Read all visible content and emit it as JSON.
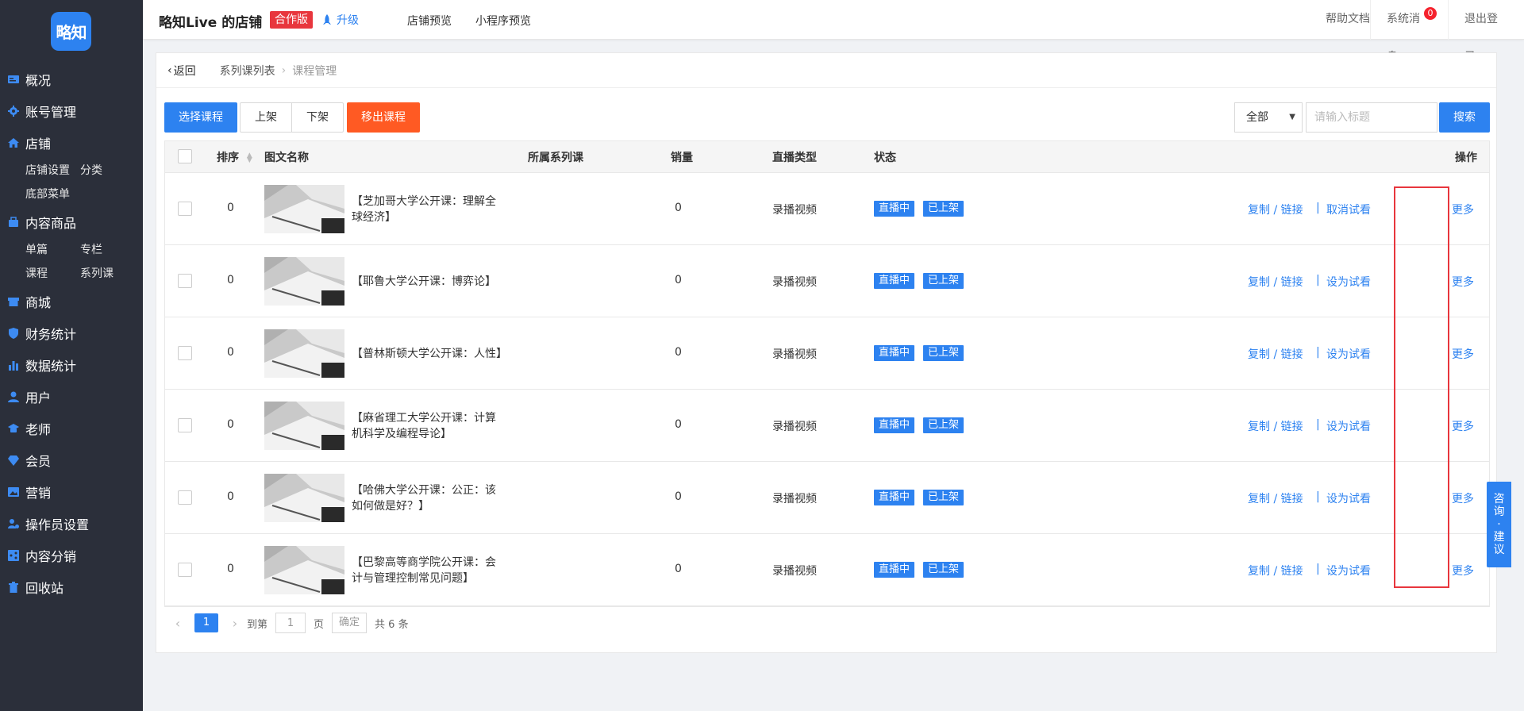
{
  "sidebar": {
    "logo_text": "略知",
    "groups": [
      {
        "label": "概况",
        "icon": "card-icon"
      },
      {
        "label": "账号管理",
        "icon": "gear-icon"
      },
      {
        "label": "店铺",
        "icon": "home-icon",
        "subs": [
          "店铺设置",
          "分类",
          "底部菜单"
        ]
      },
      {
        "label": "内容商品",
        "icon": "bag-icon",
        "subs": [
          "单篇",
          "专栏",
          "课程",
          "系列课"
        ]
      },
      {
        "label": "商城",
        "icon": "store-icon"
      },
      {
        "label": "财务统计",
        "icon": "shield-icon"
      },
      {
        "label": "数据统计",
        "icon": "bar-chart-icon"
      },
      {
        "label": "用户",
        "icon": "user-icon"
      },
      {
        "label": "老师",
        "icon": "mortarboard-icon"
      },
      {
        "label": "会员",
        "icon": "diamond-icon"
      },
      {
        "label": "营销",
        "icon": "picture-icon"
      },
      {
        "label": "操作员设置",
        "icon": "user-gear-icon"
      },
      {
        "label": "内容分销",
        "icon": "share-icon"
      },
      {
        "label": "回收站",
        "icon": "trash-icon"
      }
    ]
  },
  "header": {
    "shop_title": "略知Live 的店铺",
    "edition_badge": "合作版",
    "upgrade_label": "升级",
    "links": [
      "店铺预览",
      "小程序预览"
    ],
    "help": "帮助文档",
    "messages": "系统消息",
    "message_count": "0",
    "logout": "退出登录"
  },
  "breadcrumb": {
    "back": "返回",
    "parent": "系列课列表",
    "current": "课程管理"
  },
  "toolbar": {
    "select_course": "选择课程",
    "list_on": "上架",
    "list_off": "下架",
    "remove_course": "移出课程",
    "filter_value": "全部",
    "search_placeholder": "请输入标题",
    "search": "搜索"
  },
  "table": {
    "headers": {
      "sort": "排序",
      "name": "图文名称",
      "series": "所属系列课",
      "sales": "销量",
      "live_type": "直播类型",
      "status": "状态",
      "actions": "操作"
    },
    "rows": [
      {
        "sort": "0",
        "title": "【芝加哥大学公开课：理解全球经济】",
        "sales": "0",
        "live_type": "录播视频",
        "tag_live": "直播中",
        "tag_listed": "已上架",
        "copy": "复制 / 链接",
        "trial": "取消试看",
        "more": "更多"
      },
      {
        "sort": "0",
        "title": "【耶鲁大学公开课：博弈论】",
        "sales": "0",
        "live_type": "录播视频",
        "tag_live": "直播中",
        "tag_listed": "已上架",
        "copy": "复制 / 链接",
        "trial": "设为试看",
        "more": "更多"
      },
      {
        "sort": "0",
        "title": "【普林斯顿大学公开课：人性】",
        "sales": "0",
        "live_type": "录播视频",
        "tag_live": "直播中",
        "tag_listed": "已上架",
        "copy": "复制 / 链接",
        "trial": "设为试看",
        "more": "更多"
      },
      {
        "sort": "0",
        "title": "【麻省理工大学公开课：计算机科学及编程导论】",
        "sales": "0",
        "live_type": "录播视频",
        "tag_live": "直播中",
        "tag_listed": "已上架",
        "copy": "复制 / 链接",
        "trial": "设为试看",
        "more": "更多"
      },
      {
        "sort": "0",
        "title": "【哈佛大学公开课：公正：该如何做是好？】",
        "sales": "0",
        "live_type": "录播视频",
        "tag_live": "直播中",
        "tag_listed": "已上架",
        "copy": "复制 / 链接",
        "trial": "设为试看",
        "more": "更多"
      },
      {
        "sort": "0",
        "title": "【巴黎高等商学院公开课：会计与管理控制常见问题】",
        "sales": "0",
        "live_type": "录播视频",
        "tag_live": "直播中",
        "tag_listed": "已上架",
        "copy": "复制 / 链接",
        "trial": "设为试看",
        "more": "更多"
      }
    ]
  },
  "pagination": {
    "current_page": "1",
    "goto_label": "到第",
    "page_input": "1",
    "page_unit": "页",
    "confirm": "确定",
    "total": "共 6 条"
  },
  "feedback": {
    "label": "咨询·建议"
  },
  "colors": {
    "accent": "#2d82f0",
    "danger": "#ff5a23",
    "badge_red": "#e8363d",
    "sidebar_bg": "#2b2f3a"
  }
}
